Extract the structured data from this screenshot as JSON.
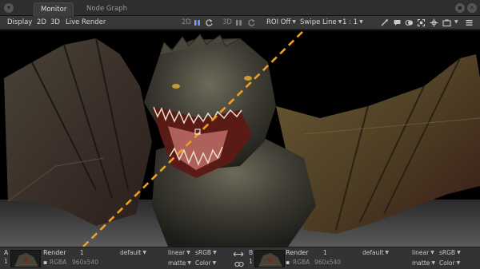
{
  "tabs": {
    "monitor": "Monitor",
    "node_graph": "Node Graph"
  },
  "menu": {
    "display": "Display",
    "two_d": "2D",
    "three_d": "3D",
    "live_render": "Live Render"
  },
  "viewer_toolbar": {
    "mode_2d": "2D",
    "mode_3d": "3D",
    "roi": "ROI Off",
    "swipe": "Swipe Line",
    "zoom": "1 : 1"
  },
  "slot_a": {
    "letter": "A",
    "index": "1",
    "name": "Render",
    "frame": "1",
    "pass": "default",
    "channels": "RGBA",
    "resolution": "960x540",
    "colorspace": "linear",
    "lut": "sRGB",
    "matte": "matte",
    "color": "Color"
  },
  "slot_b": {
    "letter": "B",
    "index": "1",
    "name": "Render",
    "frame": "1",
    "pass": "default",
    "channels": "RGBA",
    "resolution": "960x540",
    "colorspace": "linear",
    "lut": "sRGB",
    "matte": "matte",
    "color": "Color"
  },
  "colors": {
    "swipe_line": "#f0a020",
    "panel_bg": "#333333",
    "toolbar_bg": "#383838"
  }
}
